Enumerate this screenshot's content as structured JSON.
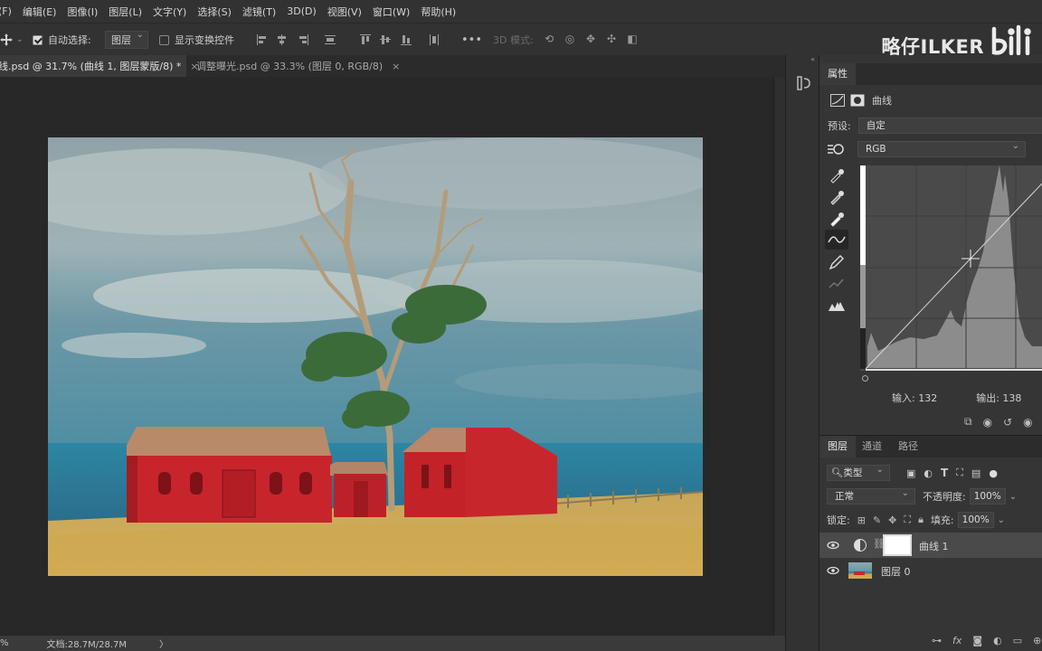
{
  "menu": [
    "(F)",
    "编辑(E)",
    "图像(I)",
    "图层(L)",
    "文字(Y)",
    "选择(S)",
    "滤镜(T)",
    "3D(D)",
    "视图(V)",
    "窗口(W)",
    "帮助(H)"
  ],
  "options_bar": {
    "auto_select_label": "自动选择:",
    "auto_select_checked": true,
    "auto_select_target": "图层",
    "show_transform_label": "显示变换控件",
    "show_transform_checked": false,
    "more": "•••",
    "mode_3d_label": "3D 模式:"
  },
  "watermark": "略仔ILKER",
  "bilibili_logo_text": "bili",
  "tabs": [
    {
      "label": "线.psd @ 31.7% (曲线 1, 图层蒙版/8) *",
      "active": true,
      "close": "×"
    },
    {
      "label": "调整曝光.psd @ 33.3% (图层 0, RGB/8)",
      "active": false,
      "close": "×"
    }
  ],
  "status": {
    "zoom": "%",
    "doc_info": "文档:28.7M/28.7M",
    "arrow": "〉"
  },
  "properties": {
    "tab": "属性",
    "layer_type": "曲线",
    "preset_label": "预设:",
    "preset_value": "自定",
    "channel": "RGB",
    "input_label": "输入: 132",
    "output_label": "输出: 138",
    "curve_point": {
      "input": 132,
      "output": 138
    }
  },
  "layers_panel": {
    "tabs": [
      "图层",
      "通道",
      "路径"
    ],
    "filter_kind": "类型",
    "blend_mode": "正常",
    "opacity_label": "不透明度:",
    "opacity_value": "100%",
    "lock_label": "锁定:",
    "fill_label": "填充:",
    "fill_value": "100%",
    "layers": [
      {
        "name": "曲线 1",
        "selected": true,
        "visible": true
      },
      {
        "name": "图层 0",
        "selected": false,
        "visible": true
      }
    ],
    "footer_icons": [
      "link-icon",
      "fx-icon",
      "mask-icon",
      "adjustment-icon",
      "group-icon",
      "new-layer-icon"
    ]
  },
  "colors": {
    "accent": "#e6e6e6",
    "panel": "#353535",
    "barn_red": "#c8242c",
    "sea": "#2f6f8f",
    "grass": "#cfa84c"
  }
}
